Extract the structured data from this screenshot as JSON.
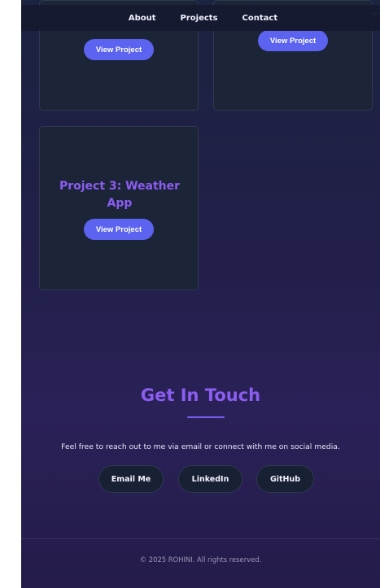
{
  "nav": {
    "items": [
      {
        "label": "About"
      },
      {
        "label": "Projects"
      },
      {
        "label": "Contact"
      }
    ]
  },
  "projects": {
    "cards": [
      {
        "title": "",
        "button": "View Project"
      },
      {
        "title": "",
        "button": "View Project"
      },
      {
        "title": "Project 3: Weather App",
        "button": "View Project"
      }
    ]
  },
  "contact": {
    "title": "Get In Touch",
    "text": "Feel free to reach out to me via email or connect with me on social media.",
    "buttons": [
      {
        "label": "Email Me"
      },
      {
        "label": "LinkedIn"
      },
      {
        "label": "GitHub"
      }
    ]
  },
  "footer": {
    "text": "© 2025 ROHINI. All rights reserved."
  },
  "colors": {
    "accent": "#8b5df0",
    "button": "#5b63f0",
    "background_top": "#1b2340",
    "background_bottom": "#2a2158",
    "card": "#1c2438"
  }
}
